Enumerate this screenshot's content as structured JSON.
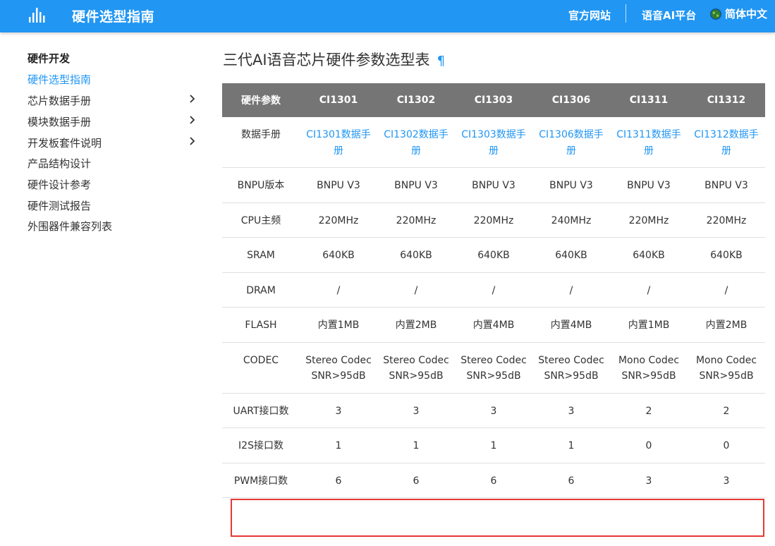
{
  "header": {
    "title": "硬件选型指南",
    "nav": {
      "official": "官方网站",
      "ai_platform": "语音AI平台",
      "language": "简体中文"
    },
    "colors": {
      "bar": "#2196f3"
    }
  },
  "sidebar": {
    "heading": "硬件开发",
    "items": [
      {
        "label": "硬件选型指南",
        "active": true,
        "expandable": false
      },
      {
        "label": "芯片数据手册",
        "active": false,
        "expandable": true
      },
      {
        "label": "模块数据手册",
        "active": false,
        "expandable": true
      },
      {
        "label": "开发板套件说明",
        "active": false,
        "expandable": true
      },
      {
        "label": "产品结构设计",
        "active": false,
        "expandable": false
      },
      {
        "label": "硬件设计参考",
        "active": false,
        "expandable": false
      },
      {
        "label": "硬件测试报告",
        "active": false,
        "expandable": false
      },
      {
        "label": "外围器件兼容列表",
        "active": false,
        "expandable": false
      }
    ]
  },
  "main": {
    "title": "三代AI语音芯片硬件参数选型表",
    "anchor": "¶",
    "table": {
      "headers": [
        "硬件参数",
        "CI1301",
        "CI1302",
        "CI1303",
        "CI1306",
        "CI1311",
        "CI1312"
      ],
      "rows": [
        {
          "label": "数据手册",
          "links": true,
          "cells": [
            "CI1301数据手册",
            "CI1302数据手册",
            "CI1303数据手册",
            "CI1306数据手册",
            "CI1311数据手册",
            "CI1312数据手册"
          ]
        },
        {
          "label": "BNPU版本",
          "cells": [
            "BNPU V3",
            "BNPU V3",
            "BNPU V3",
            "BNPU V3",
            "BNPU V3",
            "BNPU V3"
          ]
        },
        {
          "label": "CPU主频",
          "cells": [
            "220MHz",
            "220MHz",
            "220MHz",
            "240MHz",
            "220MHz",
            "220MHz"
          ]
        },
        {
          "label": "SRAM",
          "cells": [
            "640KB",
            "640KB",
            "640KB",
            "640KB",
            "640KB",
            "640KB"
          ]
        },
        {
          "label": "DRAM",
          "cells": [
            "/",
            "/",
            "/",
            "/",
            "/",
            "/"
          ]
        },
        {
          "label": "FLASH",
          "cells": [
            "内置1MB",
            "内置2MB",
            "内置4MB",
            "内置4MB",
            "内置1MB",
            "内置2MB"
          ]
        },
        {
          "label": "CODEC",
          "cells": [
            "Stereo Codec SNR>95dB",
            "Stereo Codec SNR>95dB",
            "Stereo Codec SNR>95dB",
            "Stereo Codec SNR>95dB",
            "Mono Codec SNR>95dB",
            "Mono Codec SNR>95dB"
          ]
        },
        {
          "label": "UART接口数",
          "cells": [
            "3",
            "3",
            "3",
            "3",
            "2",
            "2"
          ]
        },
        {
          "label": "I2S接口数",
          "cells": [
            "1",
            "1",
            "1",
            "1",
            "0",
            "0"
          ]
        },
        {
          "label": "PWM接口数",
          "highlighted": true,
          "cells": [
            "6",
            "6",
            "6",
            "6",
            "3",
            "3"
          ]
        }
      ]
    }
  }
}
